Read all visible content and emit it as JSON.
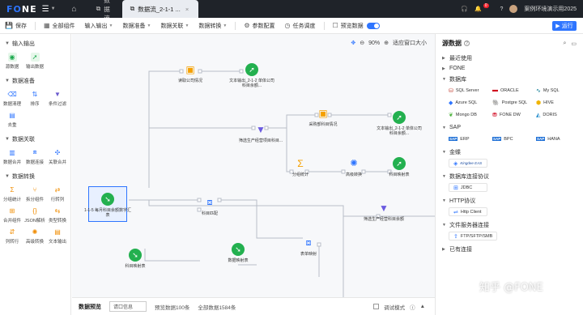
{
  "topbar": {
    "logo_prefix": "F",
    "logo_suffix": "NE",
    "tabs": [
      {
        "label": "数据流"
      },
      {
        "label": "数据流_2-1-1 ..."
      }
    ],
    "badge_count": "0",
    "user_name": "案例环境演示用2025"
  },
  "toolbar": {
    "save": "保存",
    "all_components": "全部组件",
    "input_output": "输入输出",
    "data_prep": "数据准备",
    "data_join": "数据关联",
    "data_transform": "数据转换",
    "param_config": "参数配置",
    "task_schedule": "任务调度",
    "preview_data": "预览数据",
    "run": "运行"
  },
  "left_panel": {
    "sections": [
      {
        "title": "输入输出",
        "items": [
          {
            "label": "源数据",
            "icon": "source-data-icon"
          },
          {
            "label": "输出数据",
            "icon": "output-data-icon"
          }
        ]
      },
      {
        "title": "数据准备",
        "items": [
          {
            "label": "数据清理",
            "icon": "clean-icon"
          },
          {
            "label": "排序",
            "icon": "sort-icon"
          },
          {
            "label": "条件过滤",
            "icon": "filter-icon"
          },
          {
            "label": "去重",
            "icon": "dedupe-icon"
          }
        ]
      },
      {
        "title": "数据关联",
        "items": [
          {
            "label": "数据合并",
            "icon": "merge-icon"
          },
          {
            "label": "数据连接",
            "icon": "join-icon"
          },
          {
            "label": "关联合并",
            "icon": "related-merge-icon"
          }
        ]
      },
      {
        "title": "数据转换",
        "items": [
          {
            "label": "分组统计",
            "icon": "group-stat-icon"
          },
          {
            "label": "拆分组件",
            "icon": "split-icon"
          },
          {
            "label": "行转列",
            "icon": "row-to-col-icon"
          },
          {
            "label": "合并组件",
            "icon": "combine-icon"
          },
          {
            "label": "JSON解析",
            "icon": "json-icon"
          },
          {
            "label": "类型转换",
            "icon": "type-convert-icon"
          },
          {
            "label": "列转行",
            "icon": "col-to-row-icon"
          },
          {
            "label": "高级转换",
            "icon": "advanced-icon"
          },
          {
            "label": "文本输出",
            "icon": "text-output-icon"
          }
        ]
      }
    ]
  },
  "canvas": {
    "zoom": "90%",
    "fit_window": "适应窗口大小",
    "nodes": [
      {
        "label": "读取公司情况",
        "kind": "calc"
      },
      {
        "label": "文本输出_2-1-2 单体公司科目余额...",
        "kind": "output"
      },
      {
        "label": "采购部科目情况",
        "kind": "calc"
      },
      {
        "label": "筛选生产经营项目科目...",
        "kind": "filter"
      },
      {
        "label": "文本输出_2-1-2 单体公司科目余额...",
        "kind": "output"
      },
      {
        "label": "分组统计",
        "kind": "sum"
      },
      {
        "label": "高级转换",
        "kind": "multi"
      },
      {
        "label": "科目映射表",
        "kind": "output"
      },
      {
        "label": "1-1-5 每月科目余额数字汇表",
        "kind": "source"
      },
      {
        "label": "科目匹配",
        "kind": "join"
      },
      {
        "label": "筛选生产经营科目余额",
        "kind": "filter"
      },
      {
        "label": "科目映射表",
        "kind": "source"
      },
      {
        "label": "数据映射表",
        "kind": "source"
      },
      {
        "label": "表单映射",
        "kind": "join"
      }
    ]
  },
  "bottombar": {
    "title": "数据预览",
    "select_value": "请口信息",
    "preview_count": "预览数据100条",
    "total_count": "全部数据1584条",
    "debug_mode": "调试模式"
  },
  "right_panel": {
    "title": "源数据",
    "groups": [
      {
        "title": "最近使用",
        "expanded": false,
        "chips": []
      },
      {
        "title": "FONE",
        "expanded": false,
        "chips": []
      },
      {
        "title": "数据库",
        "expanded": true,
        "chips": [
          {
            "label": "SQL Server",
            "icon": "sqlserver-icon"
          },
          {
            "label": "ORACLE",
            "icon": "oracle-icon"
          },
          {
            "label": "My SQL",
            "icon": "mysql-icon"
          },
          {
            "label": "Azure SQL",
            "icon": "azure-icon"
          },
          {
            "label": "Postgre SQL",
            "icon": "postgres-icon"
          },
          {
            "label": "HIVE",
            "icon": "hive-icon"
          },
          {
            "label": "Mongo DB",
            "icon": "mongodb-icon"
          },
          {
            "label": "FONE DW",
            "icon": "fone-dw-icon"
          },
          {
            "label": "DORIS",
            "icon": "doris-icon"
          }
        ]
      },
      {
        "title": "SAP",
        "expanded": true,
        "chips": [
          {
            "label": "ERP",
            "icon": "sap-icon"
          },
          {
            "label": "BPC",
            "icon": "sap-icon"
          },
          {
            "label": "HANA",
            "icon": "sap-icon"
          }
        ]
      },
      {
        "title": "金蝶",
        "expanded": true,
        "chips": [
          {
            "label": "Kingdee EAS",
            "icon": "kingdee-icon"
          }
        ]
      },
      {
        "title": "数据库连接协议",
        "expanded": true,
        "chips": [
          {
            "label": "JDBC",
            "icon": "jdbc-icon"
          }
        ]
      },
      {
        "title": "HTTP协议",
        "expanded": true,
        "chips": [
          {
            "label": "Http Client",
            "icon": "http-icon"
          }
        ]
      },
      {
        "title": "文件服务器连接",
        "expanded": true,
        "chips": [
          {
            "label": "FTP/SFTP/SMB",
            "icon": "ftp-icon"
          }
        ]
      },
      {
        "title": "已有连接",
        "expanded": false,
        "chips": []
      }
    ]
  },
  "watermark": "知乎 @FONE"
}
